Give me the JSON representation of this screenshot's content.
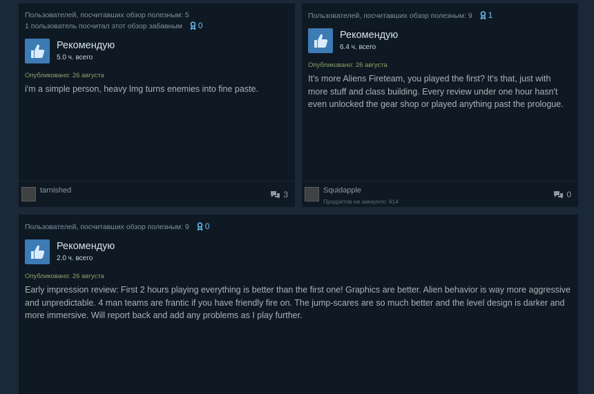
{
  "reviews": [
    {
      "helpful": "Пользователей, посчитавших обзор полезным: 5",
      "funny": "1 пользователь посчитал этот обзор забавным",
      "awards": "0",
      "recommendation": "Рекомендую",
      "hours": "5.0 ч. всего",
      "posted": "Опубликовано: 26 августа",
      "text": "i'm a simple person, heavy lmg turns enemies into fine paste.",
      "author": "tarnished",
      "products": "",
      "comments": "3"
    },
    {
      "helpful": "Пользователей, посчитавших обзор полезным: 9",
      "awards": "1",
      "recommendation": "Рекомендую",
      "hours": "6.4 ч. всего",
      "posted": "Опубликовано: 26 августа",
      "text": "It's more Aliens Fireteam, you played the first? It's that, just with more stuff and class building. Every review under one hour hasn't even unlocked the gear shop or played anything past the prologue.",
      "author": "Squidapple",
      "products": "Продуктов на аккаунте: 414",
      "comments": "0"
    },
    {
      "helpful": "Пользователей, посчитавших обзор полезным: 9",
      "awards": "0",
      "recommendation": "Рекомендую",
      "hours": "2.0 ч. всего",
      "posted": "Опубликовано: 26 августа",
      "text": "Early impression review: First 2 hours playing everything is better than the first one! Graphics are better. Alien behavior is way more aggressive and unpredictable. 4 man teams are frantic if you have friendly fire on. The jump-scares are so much better and the level design is darker and more immersive. Will report back and add any problems as I play further."
    }
  ],
  "colors": {
    "background": "#1b2838",
    "card": "#0f1923",
    "award_blue": "#66c0f4",
    "thumb_blue": "#3d7bb5",
    "posted_green": "#8ba26a"
  },
  "icons": {
    "thumb": "thumbs-up-icon",
    "award": "award-ribbon-icon",
    "comment": "comment-bubbles-icon"
  }
}
